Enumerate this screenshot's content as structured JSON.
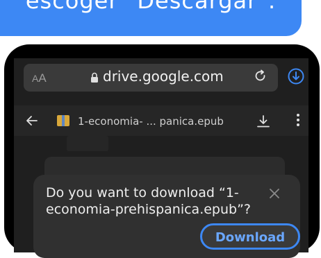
{
  "banner": {
    "text": "escoger \"Descargar\"."
  },
  "browser": {
    "aa_label_small": "A",
    "aa_label_big": "A",
    "url": "drive.google.com"
  },
  "viewer": {
    "file_name": "1-economia- ... panica.epub"
  },
  "dialog": {
    "message": "Do you want to download “1-economia-prehispanica.epub”?",
    "download_label": "Download"
  },
  "colors": {
    "accent": "#3d88f4",
    "banner": "#3d88f4",
    "dialog_bg": "#303030"
  }
}
